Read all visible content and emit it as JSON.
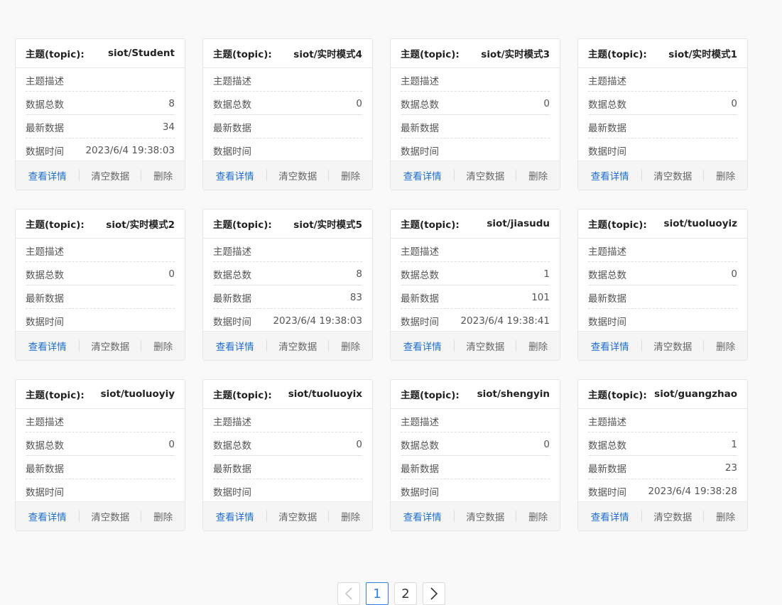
{
  "labels": {
    "topic": "主题(topic):",
    "desc": "主题描述",
    "total": "数据总数",
    "latest": "最新数据",
    "time": "数据时间",
    "view": "查看详情",
    "clear": "清空数据",
    "delete": "删除"
  },
  "cards": [
    {
      "topic": "siot/Student",
      "desc": "",
      "total": "8",
      "latest": "34",
      "time": "2023/6/4 19:38:03"
    },
    {
      "topic": "siot/实时模式4",
      "desc": "",
      "total": "0",
      "latest": "",
      "time": ""
    },
    {
      "topic": "siot/实时模式3",
      "desc": "",
      "total": "0",
      "latest": "",
      "time": ""
    },
    {
      "topic": "siot/实时模式1",
      "desc": "",
      "total": "0",
      "latest": "",
      "time": ""
    },
    {
      "topic": "siot/实时模式2",
      "desc": "",
      "total": "0",
      "latest": "",
      "time": ""
    },
    {
      "topic": "siot/实时模式5",
      "desc": "",
      "total": "8",
      "latest": "83",
      "time": "2023/6/4 19:38:03"
    },
    {
      "topic": "siot/jiasudu",
      "desc": "",
      "total": "1",
      "latest": "101",
      "time": "2023/6/4 19:38:41"
    },
    {
      "topic": "siot/tuoluoyiz",
      "desc": "",
      "total": "0",
      "latest": "",
      "time": ""
    },
    {
      "topic": "siot/tuoluoyiy",
      "desc": "",
      "total": "0",
      "latest": "",
      "time": ""
    },
    {
      "topic": "siot/tuoluoyix",
      "desc": "",
      "total": "0",
      "latest": "",
      "time": ""
    },
    {
      "topic": "siot/shengyin",
      "desc": "",
      "total": "0",
      "latest": "",
      "time": ""
    },
    {
      "topic": "siot/guangzhao",
      "desc": "",
      "total": "1",
      "latest": "23",
      "time": "2023/6/4 19:38:28"
    }
  ],
  "pagination": {
    "pages": [
      "1",
      "2"
    ],
    "current": "1"
  },
  "colors": {
    "accent": "#1f6fd1",
    "background": "#f9f9f9"
  },
  "icons": {
    "prev": "chevron-left-icon",
    "next": "chevron-right-icon"
  }
}
